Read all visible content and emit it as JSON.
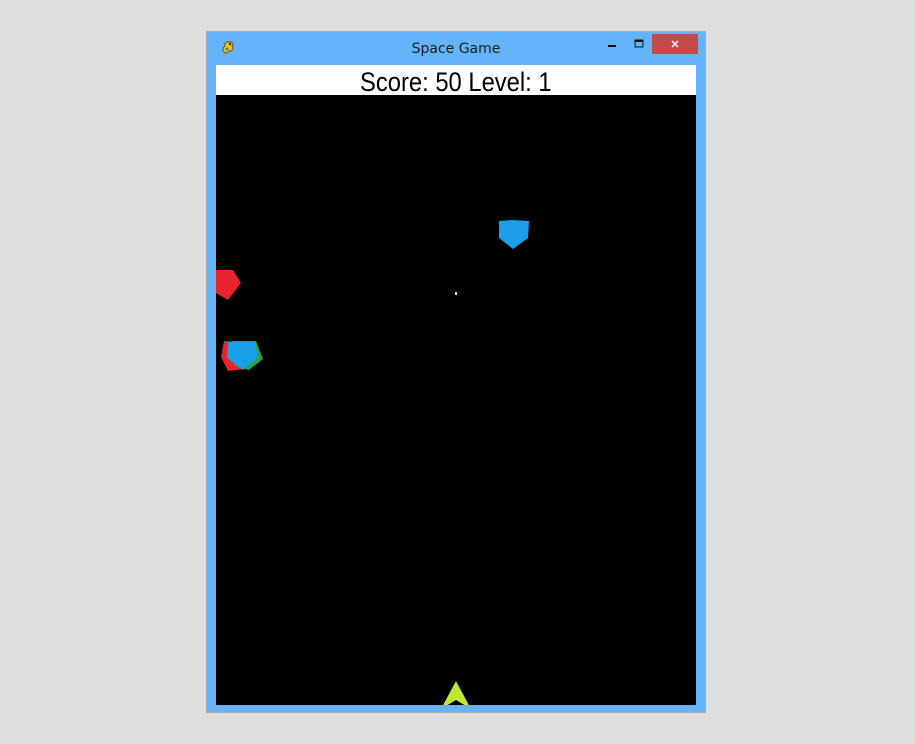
{
  "window": {
    "title": "Space Game",
    "frame_color": "#63b4fb",
    "close_color": "#c74a4a",
    "icons": {
      "app": "pygame-snake-icon",
      "minimize": "minimize-icon",
      "maximize": "maximize-icon",
      "close": "close-icon"
    }
  },
  "hud": {
    "score_label": "Score:",
    "score": 50,
    "level_label": "Level:",
    "level": 1,
    "text": "Score: 50 Level: 1"
  },
  "game": {
    "background": "#000000",
    "player": {
      "name": "player-ship",
      "color": "#bde831"
    },
    "bullet": {
      "name": "bullet",
      "color": "#ffff66"
    },
    "enemies": [
      {
        "name": "enemy-pentagon-blue-top",
        "color": "#1a9fe8"
      },
      {
        "name": "enemy-pentagon-red-left",
        "color": "#e8222e"
      },
      {
        "name": "enemy-pentagon-red-back",
        "color": "#e8222e"
      },
      {
        "name": "enemy-pentagon-green-back",
        "color": "#2aa34a"
      },
      {
        "name": "enemy-pentagon-blue-front",
        "color": "#1a9fe8"
      }
    ]
  }
}
